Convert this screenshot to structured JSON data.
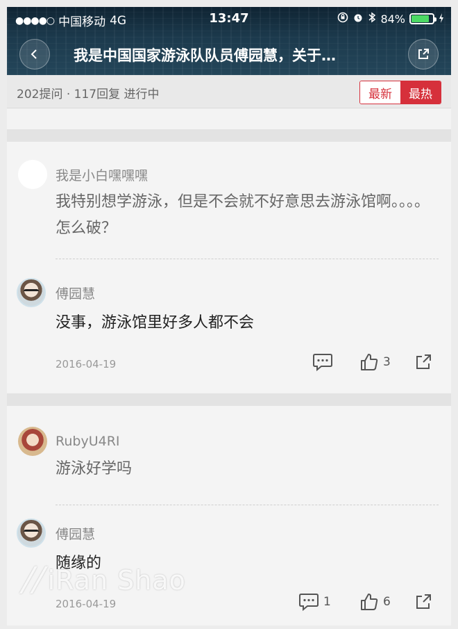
{
  "statusbar": {
    "signal_dots": "●●●●○",
    "carrier": "中国移动",
    "network": "4G",
    "time": "13:47",
    "battery": "84%",
    "battery_level": 0.84,
    "battery_color": "#4cd964"
  },
  "nav": {
    "title": "我是中国国家游泳队队员傅园慧，关于…",
    "back_icon": "chevron-left-icon",
    "share_icon": "share-icon"
  },
  "stats": {
    "text": "202提问 · 117回复  进行中",
    "sort_newest": "最新",
    "sort_hottest": "最热",
    "accent_color": "#d6303b"
  },
  "threads": [
    {
      "asker": "我是小白嘿嘿嘿",
      "question": "我特别想学游泳，但是不会就不好意思去游泳馆啊。。。。怎么破？",
      "answerer": "傅园慧",
      "answer": "没事，游泳馆里好多人都不会",
      "date": "2016-04-19",
      "comments": "",
      "likes": "3"
    },
    {
      "asker": "RubyU4RI",
      "question": "游泳好学吗",
      "answerer": "傅园慧",
      "answer": "随缘的",
      "date": "2016-04-19",
      "comments": "1",
      "likes": "6"
    }
  ],
  "watermark": "iRan Shao"
}
